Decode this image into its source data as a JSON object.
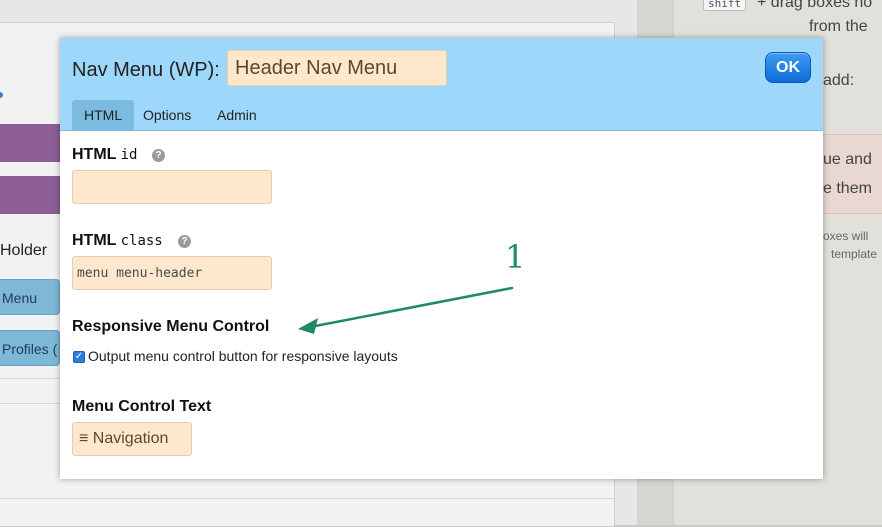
{
  "background": {
    "left": {
      "holder_text": "Holder",
      "tab_menu": "Menu",
      "tab_profiles": "Profiles ("
    },
    "right": {
      "shift_key": "shift",
      "line1": "drag boxes ho",
      "line2": "from the",
      "line3": "add:",
      "line4": "ue and",
      "line5": "e them",
      "line6": "oxes will",
      "line7": "template"
    }
  },
  "modal": {
    "title": "Nav Menu (WP):",
    "name_value": "Header Nav Menu",
    "ok_label": "OK",
    "tabs": [
      {
        "label": "HTML",
        "active": true
      },
      {
        "label": "Options",
        "active": false
      },
      {
        "label": "Admin",
        "active": false
      }
    ],
    "html_id": {
      "label_bold": "HTML",
      "label_code": "id",
      "value": ""
    },
    "html_class": {
      "label_bold": "HTML",
      "label_code": "class",
      "value": "menu menu-header"
    },
    "responsive": {
      "label": "Responsive Menu Control",
      "checkbox_label": "Output menu control button for responsive layouts",
      "checked": true
    },
    "control_text": {
      "label": "Menu Control Text",
      "value": "≡ Navigation"
    },
    "help_glyph": "?"
  },
  "annotation": {
    "number": "1",
    "color": "#1f8a66"
  }
}
